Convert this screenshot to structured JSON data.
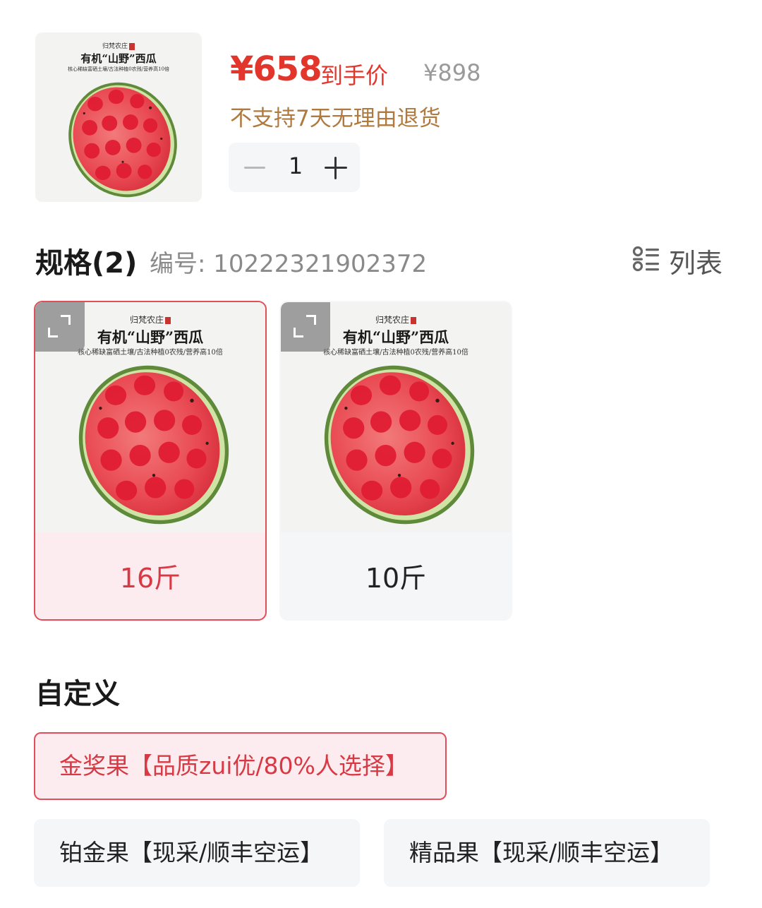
{
  "product": {
    "price": "¥658",
    "price_label": "到手价",
    "original_price": "¥898",
    "return_policy": "不支持7天无理由退货",
    "quantity": "1",
    "image": {
      "brand": "归梵农庄",
      "title": "有机“山野”西瓜",
      "subtitle": "核心稀缺富硒土壤/古法种植0农残/营养高10倍"
    }
  },
  "spec": {
    "title": "规格(2)",
    "code": "编号: 10222321902372",
    "list_label": "列表",
    "options": [
      {
        "label": "16斤",
        "selected": true
      },
      {
        "label": "10斤",
        "selected": false
      }
    ]
  },
  "custom": {
    "title": "自定义",
    "options": [
      {
        "label": "金奖果【品质zui优/80%人选择】",
        "selected": true
      },
      {
        "label": "铂金果【现采/顺丰空运】",
        "selected": false
      },
      {
        "label": "精品果【现采/顺丰空运】",
        "selected": false
      }
    ]
  },
  "colors": {
    "accent_red": "#e2352c",
    "selected_border": "#e04e5a",
    "selected_bg": "#fdecef",
    "policy_text": "#b07a3e",
    "chip_bg": "#f5f6f8"
  }
}
